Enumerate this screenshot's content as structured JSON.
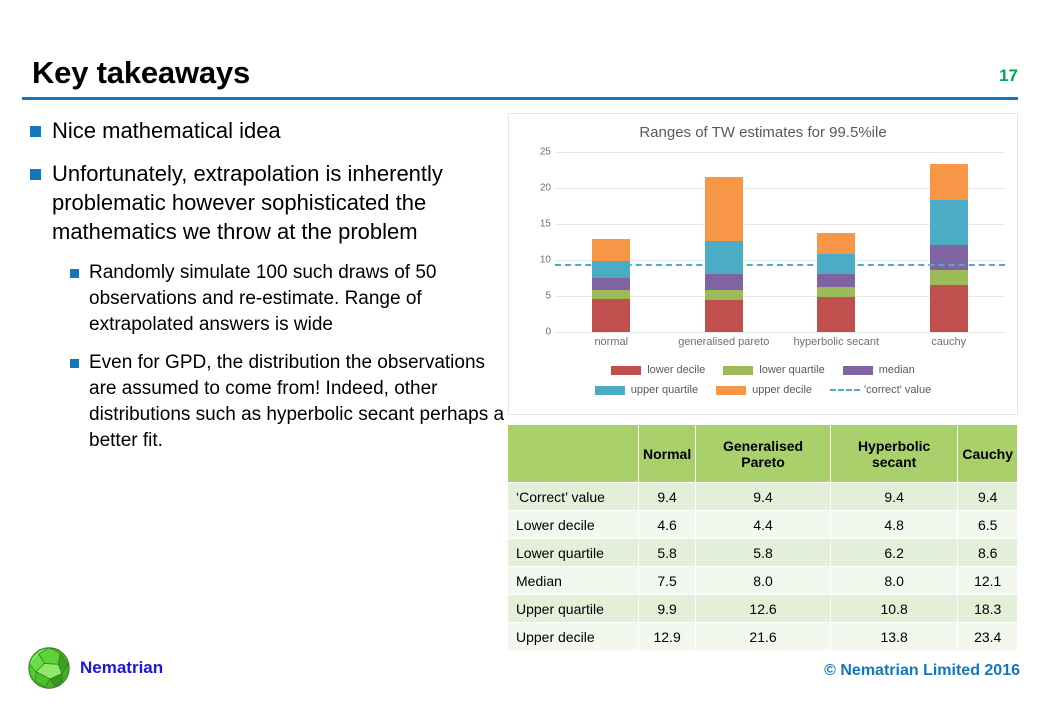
{
  "slide": {
    "title": "Key takeaways",
    "page_number": "17",
    "accent_color": "#1278BE",
    "page_number_color": "#00A550"
  },
  "bullets": [
    {
      "level": 1,
      "text": "Nice mathematical idea"
    },
    {
      "level": 1,
      "text": "Unfortunately, extrapolation is inherently problematic however sophisticated the mathematics we throw at the problem"
    },
    {
      "level": 2,
      "text": "Randomly simulate 100 such draws of 50 observations and re-estimate. Range of extrapolated answers is wide"
    },
    {
      "level": 2,
      "text": "Even for GPD, the distribution the observations are assumed to come from! Indeed, other distributions such as hyperbolic secant perhaps a better fit."
    }
  ],
  "chart_data": {
    "type": "bar",
    "stacked": true,
    "title": "Ranges of TW estimates for 99.5%ile",
    "xlabel": "",
    "ylabel": "",
    "ylim": [
      0,
      25
    ],
    "yticks": [
      25,
      20,
      15,
      10,
      5,
      0
    ],
    "grid": true,
    "legend_position": "bottom",
    "categories": [
      "normal",
      "generalised pareto",
      "hyperbolic secant",
      "cauchy"
    ],
    "series": [
      {
        "name": "lower decile",
        "color": "#C0504D",
        "values": [
          4.6,
          4.4,
          4.8,
          6.5
        ]
      },
      {
        "name": "lower quartile",
        "color": "#9BBB59",
        "values": [
          5.8,
          5.8,
          6.2,
          8.6
        ]
      },
      {
        "name": "median",
        "color": "#8064A2",
        "values": [
          7.5,
          8.0,
          8.0,
          12.1
        ]
      },
      {
        "name": "upper quartile",
        "color": "#4BACC6",
        "values": [
          9.9,
          12.6,
          10.8,
          18.3
        ]
      },
      {
        "name": "upper decile",
        "color": "#F79646",
        "values": [
          12.9,
          21.6,
          13.8,
          23.4
        ]
      }
    ],
    "segments": [
      {
        "name": "lower decile",
        "color": "#C0504D",
        "values": [
          4.6,
          4.4,
          4.8,
          6.5
        ]
      },
      {
        "name": "lower quartile",
        "color": "#9BBB59",
        "values": [
          1.2,
          1.4,
          1.4,
          2.1
        ]
      },
      {
        "name": "median",
        "color": "#8064A2",
        "values": [
          1.7,
          2.2,
          1.8,
          3.5
        ]
      },
      {
        "name": "upper quartile",
        "color": "#4BACC6",
        "values": [
          2.4,
          4.6,
          2.8,
          6.2
        ]
      },
      {
        "name": "upper decile",
        "color": "#F79646",
        "values": [
          3.0,
          9.0,
          3.0,
          5.1
        ]
      }
    ],
    "reference_line": {
      "name": "'correct' value",
      "value": 9.4,
      "color": "#4BACC6",
      "style": "dashed"
    },
    "legend": [
      {
        "label": "lower decile",
        "color": "#C0504D",
        "style": "box"
      },
      {
        "label": "lower quartile",
        "color": "#9BBB59",
        "style": "box"
      },
      {
        "label": "median",
        "color": "#8064A2",
        "style": "box"
      },
      {
        "label": "upper quartile",
        "color": "#4BACC6",
        "style": "box"
      },
      {
        "label": "upper decile",
        "color": "#F79646",
        "style": "box"
      },
      {
        "label": "'correct' value",
        "color": "#4BACC6",
        "style": "dashed"
      }
    ]
  },
  "table": {
    "columns": [
      "",
      "Normal",
      "Generalised Pareto",
      "Hyperbolic secant",
      "Cauchy"
    ],
    "rows": [
      {
        "label": "‘Correct’ value",
        "values": [
          "9.4",
          "9.4",
          "9.4",
          "9.4"
        ]
      },
      {
        "label": "Lower decile",
        "values": [
          "4.6",
          "4.4",
          "4.8",
          "6.5"
        ]
      },
      {
        "label": "Lower quartile",
        "values": [
          "5.8",
          "5.8",
          "6.2",
          "8.6"
        ]
      },
      {
        "label": "Median",
        "values": [
          "7.5",
          "8.0",
          "8.0",
          "12.1"
        ]
      },
      {
        "label": "Upper quartile",
        "values": [
          "9.9",
          "12.6",
          "10.8",
          "18.3"
        ]
      },
      {
        "label": "Upper decile",
        "values": [
          "12.9",
          "21.6",
          "13.8",
          "23.4"
        ]
      }
    ],
    "header_color": "#A9D06B",
    "row_colors": [
      "#E3EFD9",
      "#F3F8EF"
    ]
  },
  "footer": {
    "logo_text": "Nematrian",
    "logo_icon": "polyhedron-globe-icon",
    "copyright": "© Nematrian Limited 2016",
    "copyright_color": "#1278BE"
  }
}
